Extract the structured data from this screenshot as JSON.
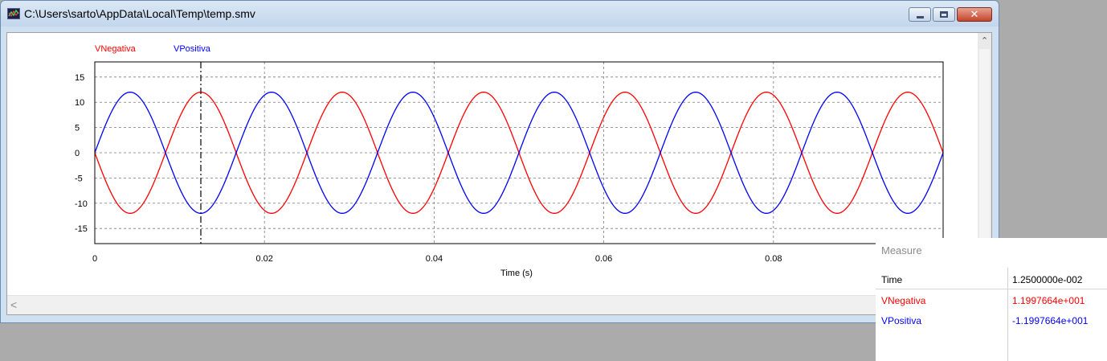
{
  "window": {
    "title": "C:\\Users\\sarto\\AppData\\Local\\Temp\\temp.smv",
    "minimize_glyph": "",
    "maximize_glyph": "",
    "close_glyph": "✕"
  },
  "scrollbars": {
    "up_arrow": "⌃",
    "left_arrow": "<"
  },
  "colors": {
    "vnegativa": "#ff0000",
    "vpositiva": "#0000ff",
    "grid": "#7a7a7a"
  },
  "chart_data": {
    "type": "line",
    "xlabel": "Time (s)",
    "ylabel": "",
    "xlim": [
      0,
      0.1
    ],
    "ylim": [
      -18,
      18
    ],
    "x_ticks": [
      0,
      0.02,
      0.04,
      0.06,
      0.08
    ],
    "x_tick_labels": [
      "0",
      "0.02",
      "0.04",
      "0.06",
      "0.08"
    ],
    "y_ticks": [
      15,
      10,
      5,
      0,
      -5,
      -10,
      -15
    ],
    "y_tick_labels": [
      "15",
      "10",
      "5",
      "0",
      "-5",
      "-10",
      "-15"
    ],
    "grid": true,
    "legend_position": "top-left",
    "cursor_x": 0.0125,
    "series": [
      {
        "name": "VNegativa",
        "color": "#ff0000",
        "amplitude": 12,
        "frequency_hz": 60,
        "phase": "negative-sine"
      },
      {
        "name": "VPositiva",
        "color": "#0000ff",
        "amplitude": 12,
        "frequency_hz": 60,
        "phase": "positive-sine"
      }
    ]
  },
  "measure": {
    "title": "Measure",
    "rows": [
      {
        "label": "Time",
        "value": "1.2500000e-002",
        "color": "#000000"
      },
      {
        "label": "VNegativa",
        "value": "1.1997664e+001",
        "color": "#ff0000"
      },
      {
        "label": "VPositiva",
        "value": "-1.1997664e+001",
        "color": "#0000ff"
      }
    ]
  }
}
